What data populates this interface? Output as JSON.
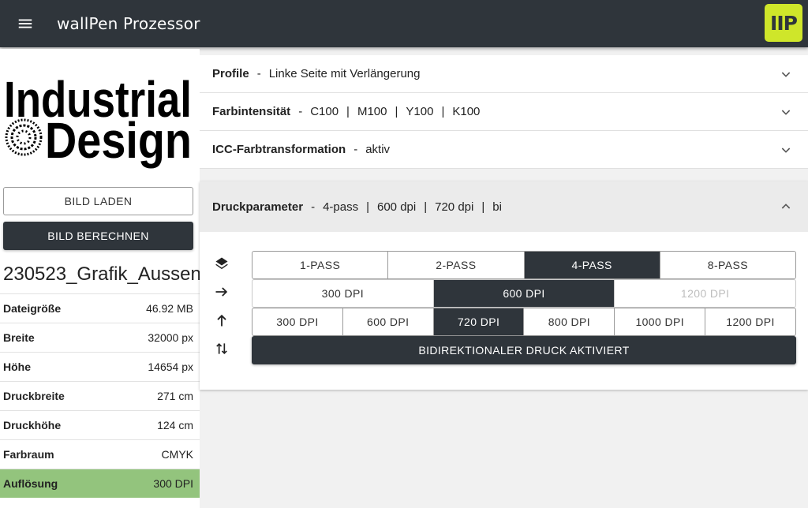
{
  "header": {
    "menu_icon": "menu-icon",
    "title": "wallPen Prozessor",
    "brand": "IIP",
    "bg_color": "#2f353b",
    "brand_color": "#cfe62a"
  },
  "left": {
    "logo": {
      "line1": "Industrial",
      "line2": "Design"
    },
    "load_button": "BILD LADEN",
    "calc_button": "BILD BERECHNEN",
    "file_name": "230523_Grafik_Aussen",
    "properties": [
      {
        "key": "Dateigröße",
        "value": "46.92 MB"
      },
      {
        "key": "Breite",
        "value": "32000 px"
      },
      {
        "key": "Höhe",
        "value": "14654 px"
      },
      {
        "key": "Druckbreite",
        "value": "271 cm"
      },
      {
        "key": "Druckhöhe",
        "value": "124 cm"
      },
      {
        "key": "Farbraum",
        "value": "CMYK"
      },
      {
        "key": "Auflösung",
        "value": "300 DPI"
      }
    ],
    "highlight_color": "#93c47d"
  },
  "accordion": {
    "profile": {
      "title": "Profile",
      "sep": "-",
      "value": "Linke Seite mit Verlängerung"
    },
    "intensity": {
      "title": "Farbintensität",
      "sep": "-",
      "values": [
        "C100",
        "M100",
        "Y100",
        "K100"
      ],
      "divider": "|"
    },
    "icc": {
      "title": "ICC-Farbtransformation",
      "sep": "-",
      "value": "aktiv"
    },
    "druck": {
      "title": "Druckparameter",
      "sep": "-",
      "values": [
        "4-pass",
        "600 dpi",
        "720 dpi",
        "bi"
      ],
      "divider": "|"
    }
  },
  "params": {
    "icons": [
      "layers-icon",
      "arrow-right-icon",
      "arrow-up-icon",
      "swap-vertical-icon"
    ],
    "pass_options": [
      "1-PASS",
      "2-PASS",
      "4-PASS",
      "8-PASS"
    ],
    "pass_selected": "4-PASS",
    "x_dpi_options": [
      "300 DPI",
      "600 DPI",
      "1200 DPI"
    ],
    "x_dpi_selected": "600 DPI",
    "x_dpi_disabled": "1200 DPI",
    "y_dpi_options": [
      "300 DPI",
      "600 DPI",
      "720 DPI",
      "800 DPI",
      "1000 DPI",
      "1200 DPI"
    ],
    "y_dpi_selected": "720 DPI",
    "bidi_button": "BIDIREKTIONALER DRUCK AKTIVIERT"
  }
}
